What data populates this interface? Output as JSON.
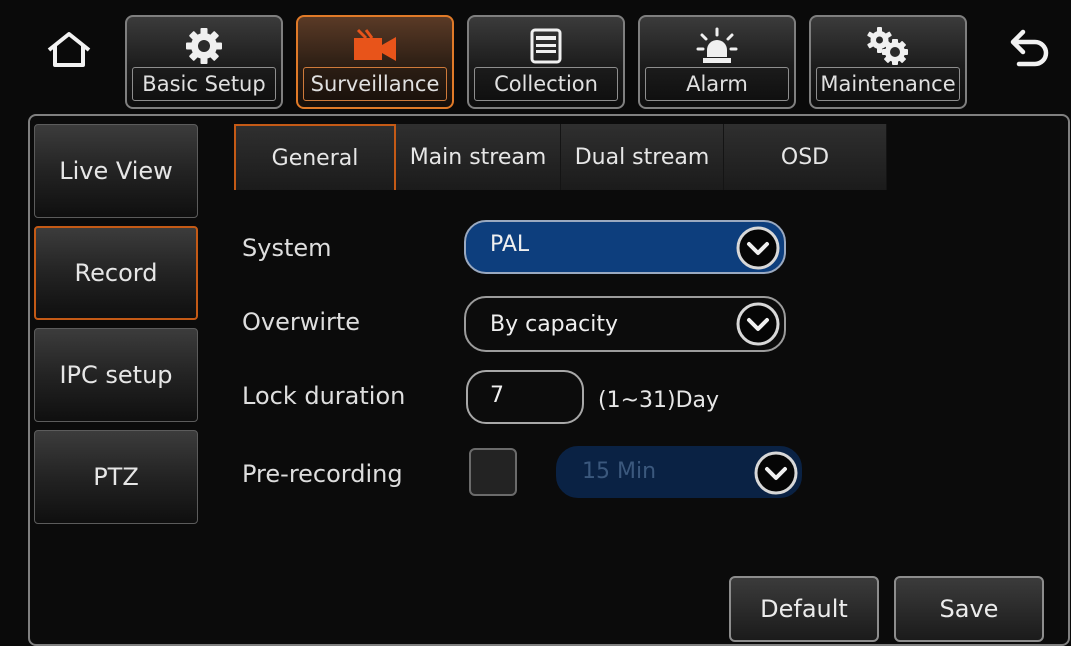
{
  "topbar": {
    "tabs": [
      {
        "label": "Basic Setup",
        "icon": "gear-icon"
      },
      {
        "label": "Surveillance",
        "icon": "camera-icon",
        "active": true
      },
      {
        "label": "Collection",
        "icon": "folder-icon"
      },
      {
        "label": "Alarm",
        "icon": "alarm-light-icon"
      },
      {
        "label": "Maintenance",
        "icon": "gears-icon"
      }
    ]
  },
  "sidebar": {
    "items": [
      {
        "label": "Live View"
      },
      {
        "label": "Record",
        "active": true
      },
      {
        "label": "IPC setup"
      },
      {
        "label": "PTZ"
      }
    ]
  },
  "subtabs": [
    {
      "label": "General",
      "active": true
    },
    {
      "label": "Main stream"
    },
    {
      "label": "Dual stream"
    },
    {
      "label": "OSD"
    }
  ],
  "form": {
    "system": {
      "label": "System",
      "value": "PAL"
    },
    "overwrite": {
      "label": "Overwirte",
      "value": "By capacity"
    },
    "lock_duration": {
      "label": "Lock duration",
      "value": "7",
      "hint": "(1~31)Day"
    },
    "pre_recording": {
      "label": "Pre-recording",
      "checked": false,
      "value": "15 Min"
    }
  },
  "actions": {
    "default_label": "Default",
    "save_label": "Save"
  },
  "colors": {
    "accent": "#e07a28",
    "select_active": "#0d3e7d",
    "select_disabled": "#0a2244"
  }
}
